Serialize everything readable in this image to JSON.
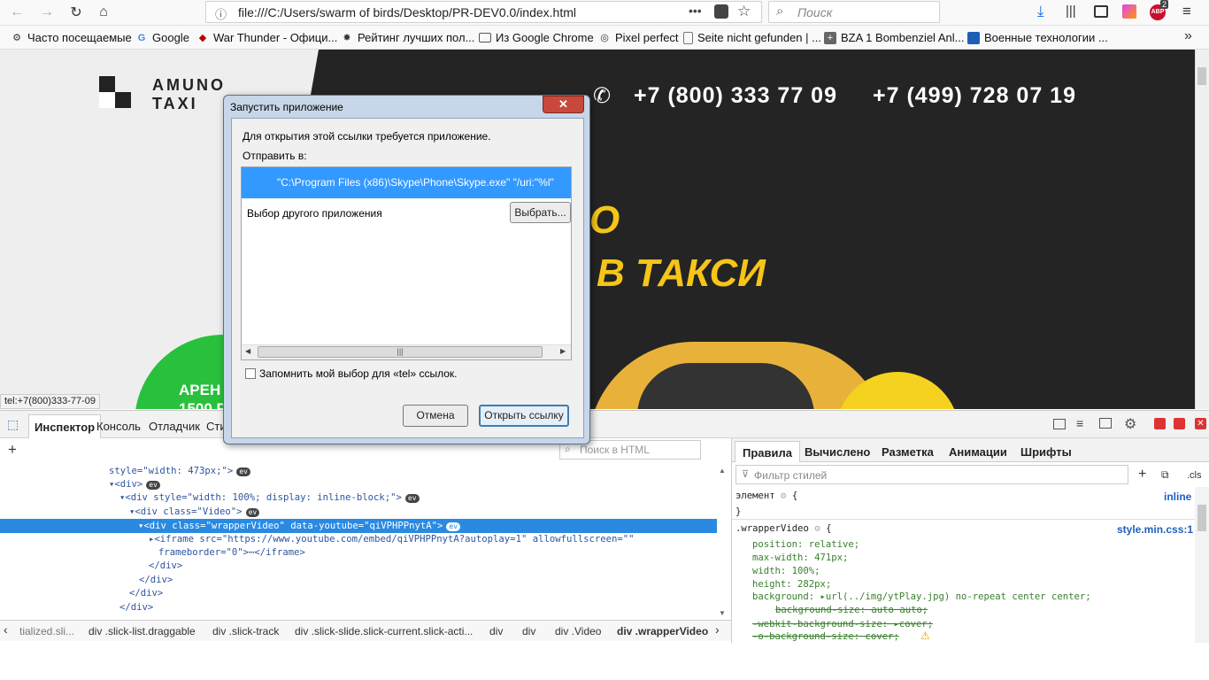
{
  "browser": {
    "url": "file:///C:/Users/swarm of birds/Desktop/PR-DEV0.0/index.html",
    "search_placeholder": "Поиск",
    "addon_badge": "2",
    "addon_label": "ABP"
  },
  "bookmarks": [
    {
      "label": "Часто посещаемые",
      "icon": "gear-icon"
    },
    {
      "label": "Google",
      "icon": "google-icon"
    },
    {
      "label": "War Thunder - Офици...",
      "icon": "war-thunder-icon"
    },
    {
      "label": "Рейтинг лучших пол...",
      "icon": "star-icon"
    },
    {
      "label": "Из Google Chrome",
      "icon": "folder-icon"
    },
    {
      "label": "Pixel perfect",
      "icon": "globe-icon"
    },
    {
      "label": "Seite nicht gefunden | ...",
      "icon": "page-icon"
    },
    {
      "label": "BZA 1 Bombenziel Anl...",
      "icon": "plus-icon"
    },
    {
      "label": "Военные технологии ...",
      "icon": "bookmark-icon"
    }
  ],
  "site": {
    "logo_line1": "AMUNO",
    "logo_line2": "TAXI",
    "phone1": "+7 (800) 333 77 09",
    "phone2": "+7 (499) 728 07 19",
    "hero_line1": "О",
    "hero_line2": "В ТАКСИ",
    "badge_line1": "АРЕН",
    "badge_line2": "1500 Р",
    "status_tooltip": "tel:+7(800)333-77-09"
  },
  "dialog": {
    "title": "Запустить приложение",
    "close_label": "✕",
    "message": "Для открытия этой ссылки требуется приложение.",
    "send_label": "Отправить в:",
    "selected_app": "\"C:\\Program Files (x86)\\Skype\\Phone\\Skype.exe\" \"/uri:\"%l\"",
    "other_app": "Выбор другого приложения",
    "choose_button": "Выбрать...",
    "remember_label": "Запомнить мой выбор для «tel» ссылок.",
    "cancel_button": "Отмена",
    "open_button": "Открыть ссылку"
  },
  "devtools": {
    "tabs": [
      "Инспектор",
      "Консоль",
      "Отладчик",
      "Сти"
    ],
    "html_search_placeholder": "Поиск в HTML",
    "code_lines": [
      {
        "text": "style=\"width: 473px;\">",
        "ev": true
      },
      {
        "text": "▾<div>",
        "ev": true
      },
      {
        "text": "▾<div style=\"width: 100%; display: inline-block;\">",
        "ev": true
      },
      {
        "text": "▾<div class=\"Video\">",
        "ev": true
      },
      {
        "text": "▾<div class=\"wrapperVideo\" data-youtube=\"qiVPHPPnytA\">",
        "ev": true
      },
      {
        "text": "▸<iframe src=\"https://www.youtube.com/embed/qiVPHPPnytA?autoplay=1\" allowfullscreen=\"\"",
        "ev": false
      },
      {
        "text": "frameborder=\"0\">⋯</iframe>",
        "ev": false
      },
      {
        "text": "</div>",
        "ev": false
      },
      {
        "text": "</div>",
        "ev": false
      },
      {
        "text": "</div>",
        "ev": false
      },
      {
        "text": "</div>",
        "ev": false
      }
    ],
    "breadcrumbs": [
      "tialized.sli...",
      "div .slick-list.draggable",
      "div .slick-track",
      "div .slick-slide.slick-current.slick-acti...",
      "div",
      "div",
      "div .Video",
      "div .wrapperVideo"
    ],
    "rules_tabs": [
      "Правила",
      "Вычислено",
      "Разметка",
      "Анимации",
      "Шрифты"
    ],
    "filter_placeholder": "Фильтр стилей",
    "cls_label": ".cls",
    "element_rule": "элемент",
    "element_source": "inline",
    "selector": ".wrapperVideo",
    "selector_source": "style.min.css:1",
    "declarations": [
      {
        "text": "position: relative;",
        "struck": false
      },
      {
        "text": "max-width: 471px;",
        "struck": false
      },
      {
        "text": "width: 100%;",
        "struck": false
      },
      {
        "text": "height: 282px;",
        "struck": false
      },
      {
        "text": "background: ▸url(../img/ytPlay.jpg) no-repeat center center;",
        "struck": false
      },
      {
        "text": "background-size: auto auto;",
        "struck": true
      },
      {
        "text": "-webkit-background-size: ▸cover;",
        "struck": true
      },
      {
        "text": "-o-background-size: cover;",
        "struck": true
      }
    ]
  }
}
